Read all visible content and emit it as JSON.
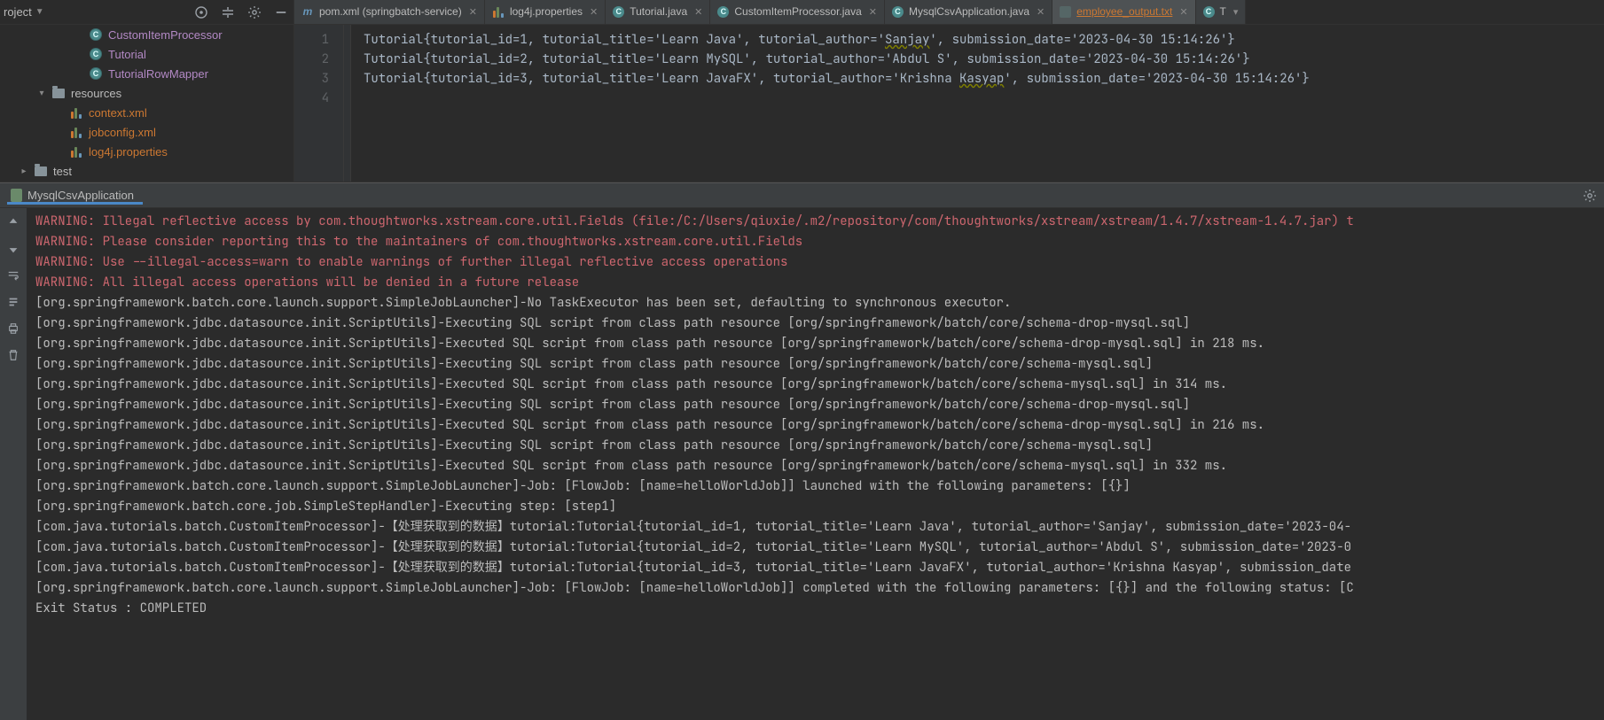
{
  "topbar": {
    "project_label": "roject",
    "gear_icon": "gear",
    "collapse_icon": "collapse",
    "target_icon": "target"
  },
  "tree": {
    "items": [
      {
        "indent": 84,
        "type": "class",
        "label": "CustomItemProcessor"
      },
      {
        "indent": 84,
        "type": "class",
        "label": "Tutorial"
      },
      {
        "indent": 84,
        "type": "class",
        "label": "TutorialRowMapper"
      },
      {
        "indent": 42,
        "type": "folder",
        "label": "resources",
        "twisty": "▾"
      },
      {
        "indent": 62,
        "type": "xml",
        "label": "context.xml"
      },
      {
        "indent": 62,
        "type": "xml",
        "label": "jobconfig.xml"
      },
      {
        "indent": 62,
        "type": "prop",
        "label": "log4j.properties"
      },
      {
        "indent": 22,
        "type": "folder",
        "label": "test",
        "twisty": "▸"
      }
    ]
  },
  "tabs": [
    {
      "kind": "m",
      "name": "pom.xml (springbatch-service)"
    },
    {
      "kind": "bar",
      "name": "log4j.properties"
    },
    {
      "kind": "c",
      "name": "Tutorial.java"
    },
    {
      "kind": "c",
      "name": "CustomItemProcessor.java"
    },
    {
      "kind": "c",
      "name": "MysqlCsvApplication.java"
    },
    {
      "kind": "txt",
      "name": "employee_output.txt",
      "active": true,
      "highlight": true
    },
    {
      "kind": "c",
      "name": "T",
      "truncated": true
    }
  ],
  "editor": {
    "gutter": [
      "1",
      "2",
      "3",
      "4"
    ],
    "lines": [
      {
        "pre": "Tutorial{tutorial_id=1, tutorial_title='Learn Java', tutorial_author='",
        "warn": "Sanjay",
        "post": "', submission_date='2023-04-30 15:14:26'}"
      },
      {
        "pre": "Tutorial{tutorial_id=2, tutorial_title='Learn MySQL', tutorial_author='Abdul S', submission_date='2023-04-30 15:14:26'}",
        "warn": "",
        "post": ""
      },
      {
        "pre": "Tutorial{tutorial_id=3, tutorial_title='Learn JavaFX', tutorial_author='Krishna ",
        "warn": "Kasyap",
        "post": "', submission_date='2023-04-30 15:14:26'}"
      },
      {
        "pre": "",
        "warn": "",
        "post": ""
      }
    ]
  },
  "run": {
    "tab_label": "MysqlCsvApplication",
    "lines": [
      {
        "cls": "w",
        "t": "WARNING: Illegal reflective access by com.thoughtworks.xstream.core.util.Fields (file:/C:/Users/qiuxie/.m2/repository/com/thoughtworks/xstream/xstream/1.4.7/xstream-1.4.7.jar) t"
      },
      {
        "cls": "w",
        "t": "WARNING: Please consider reporting this to the maintainers of com.thoughtworks.xstream.core.util.Fields"
      },
      {
        "cls": "w",
        "t": "WARNING: Use --illegal-access=warn to enable warnings of further illegal reflective access operations"
      },
      {
        "cls": "w",
        "t": "WARNING: All illegal access operations will be denied in a future release"
      },
      {
        "cls": "",
        "t": "[org.springframework.batch.core.launch.support.SimpleJobLauncher]-No TaskExecutor has been set, defaulting to synchronous executor."
      },
      {
        "cls": "",
        "t": "[org.springframework.jdbc.datasource.init.ScriptUtils]-Executing SQL script from class path resource [org/springframework/batch/core/schema-drop-mysql.sql]"
      },
      {
        "cls": "",
        "t": "[org.springframework.jdbc.datasource.init.ScriptUtils]-Executed SQL script from class path resource [org/springframework/batch/core/schema-drop-mysql.sql] in 218 ms."
      },
      {
        "cls": "",
        "t": "[org.springframework.jdbc.datasource.init.ScriptUtils]-Executing SQL script from class path resource [org/springframework/batch/core/schema-mysql.sql]"
      },
      {
        "cls": "",
        "t": "[org.springframework.jdbc.datasource.init.ScriptUtils]-Executed SQL script from class path resource [org/springframework/batch/core/schema-mysql.sql] in 314 ms."
      },
      {
        "cls": "",
        "t": "[org.springframework.jdbc.datasource.init.ScriptUtils]-Executing SQL script from class path resource [org/springframework/batch/core/schema-drop-mysql.sql]"
      },
      {
        "cls": "",
        "t": "[org.springframework.jdbc.datasource.init.ScriptUtils]-Executed SQL script from class path resource [org/springframework/batch/core/schema-drop-mysql.sql] in 216 ms."
      },
      {
        "cls": "",
        "t": "[org.springframework.jdbc.datasource.init.ScriptUtils]-Executing SQL script from class path resource [org/springframework/batch/core/schema-mysql.sql]"
      },
      {
        "cls": "",
        "t": "[org.springframework.jdbc.datasource.init.ScriptUtils]-Executed SQL script from class path resource [org/springframework/batch/core/schema-mysql.sql] in 332 ms."
      },
      {
        "cls": "",
        "t": "[org.springframework.batch.core.launch.support.SimpleJobLauncher]-Job: [FlowJob: [name=helloWorldJob]] launched with the following parameters: [{}]"
      },
      {
        "cls": "",
        "t": "[org.springframework.batch.core.job.SimpleStepHandler]-Executing step: [step1]"
      },
      {
        "cls": "",
        "t": "[com.java.tutorials.batch.CustomItemProcessor]-【处理获取到的数据】tutorial:Tutorial{tutorial_id=1, tutorial_title='Learn Java', tutorial_author='Sanjay', submission_date='2023-04-"
      },
      {
        "cls": "",
        "t": "[com.java.tutorials.batch.CustomItemProcessor]-【处理获取到的数据】tutorial:Tutorial{tutorial_id=2, tutorial_title='Learn MySQL', tutorial_author='Abdul S', submission_date='2023-0"
      },
      {
        "cls": "",
        "t": "[com.java.tutorials.batch.CustomItemProcessor]-【处理获取到的数据】tutorial:Tutorial{tutorial_id=3, tutorial_title='Learn JavaFX', tutorial_author='Krishna Kasyap', submission_date"
      },
      {
        "cls": "",
        "t": "[org.springframework.batch.core.launch.support.SimpleJobLauncher]-Job: [FlowJob: [name=helloWorldJob]] completed with the following parameters: [{}] and the following status: [C"
      },
      {
        "cls": "",
        "t": "Exit Status : COMPLETED"
      }
    ]
  }
}
